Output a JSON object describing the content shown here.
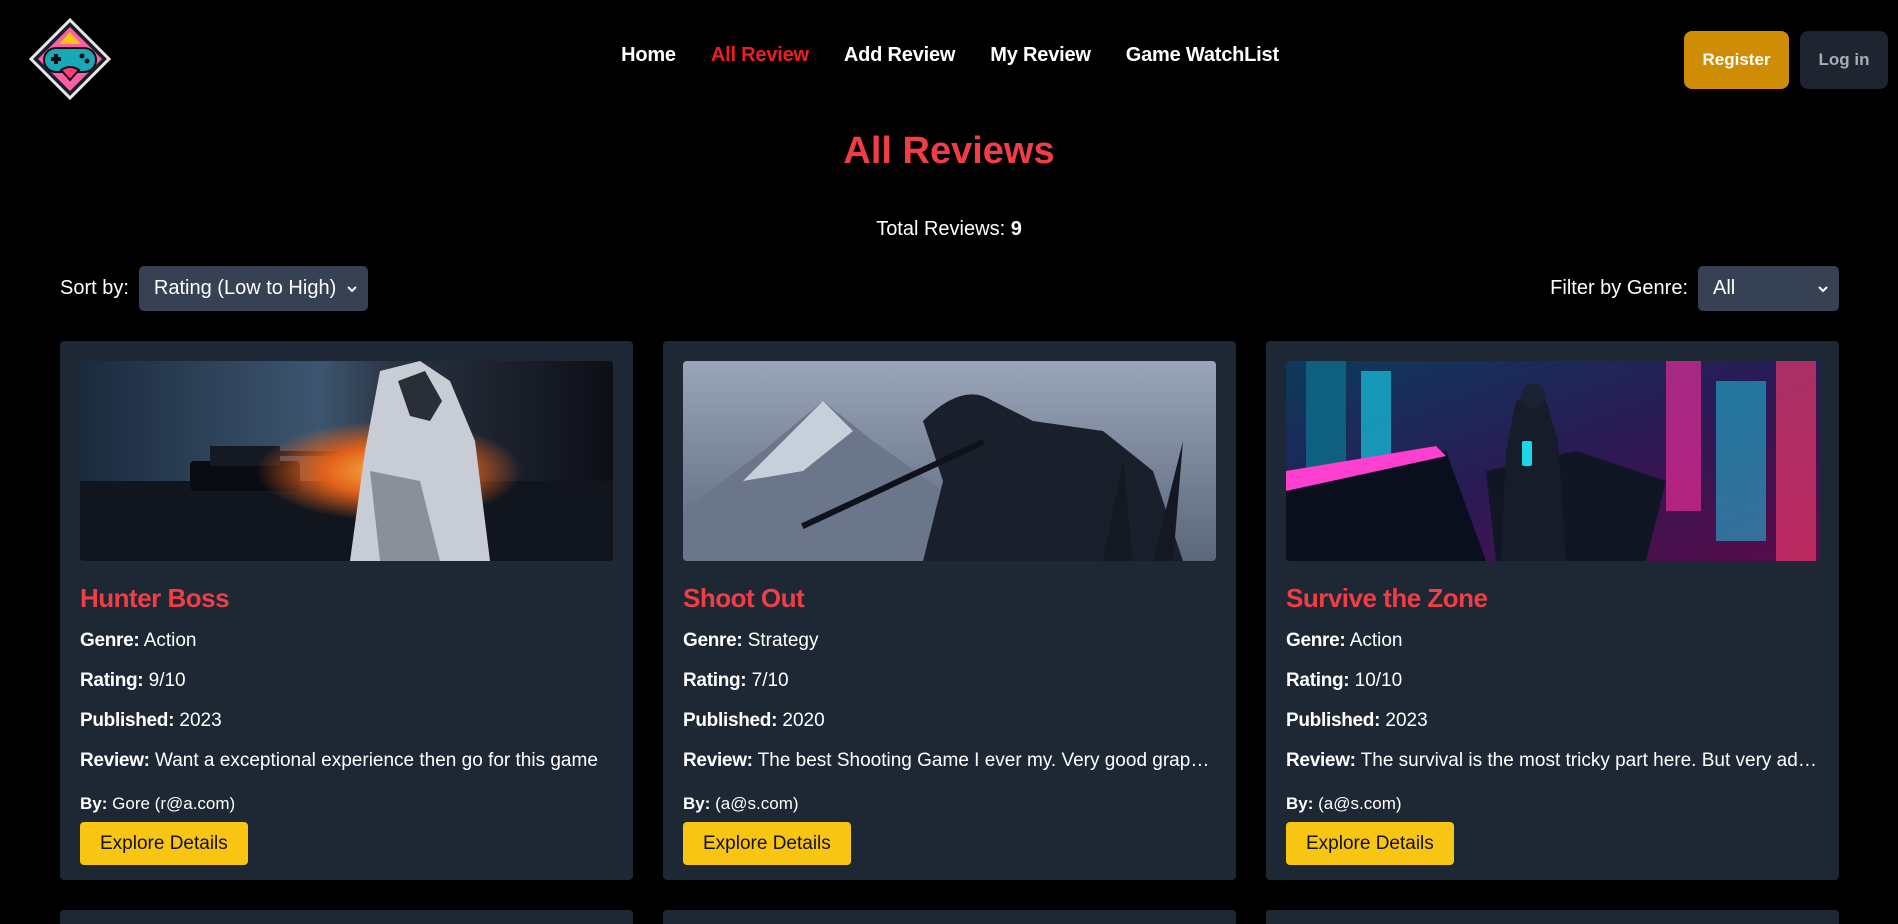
{
  "nav": {
    "links": [
      {
        "label": "Home"
      },
      {
        "label": "All Review",
        "active": true
      },
      {
        "label": "Add Review"
      },
      {
        "label": "My Review"
      },
      {
        "label": "Game WatchList"
      }
    ],
    "register_label": "Register",
    "login_label": "Log in",
    "logo_icon": "gamepad-heart-logo-icon"
  },
  "page": {
    "title": "All Reviews",
    "total_label": "Total Reviews:",
    "total_count": "9"
  },
  "controls": {
    "sort_label": "Sort by:",
    "sort_value": "Rating (Low to High)",
    "filter_label": "Filter by Genre:",
    "filter_value": "All"
  },
  "labels": {
    "genre": "Genre:",
    "rating": "Rating:",
    "published": "Published:",
    "review": "Review:",
    "by": "By:",
    "explore": "Explore Details"
  },
  "cards": [
    {
      "title": "Hunter Boss",
      "genre": "Action",
      "rating": "9/10",
      "published": "2023",
      "review": "Want a exceptional experience then go for this game",
      "by": "Gore (r@a.com)"
    },
    {
      "title": "Shoot Out",
      "genre": "Strategy",
      "rating": "7/10",
      "published": "2020",
      "review": "The best Shooting Game I ever my. Very good graphics",
      "by": "(a@s.com)"
    },
    {
      "title": "Survive the Zone",
      "genre": "Action",
      "rating": "10/10",
      "published": "2023",
      "review": "The survival is the most tricky part here. But very addictive",
      "by": "(a@s.com)"
    }
  ],
  "colors": {
    "accent_red": "#ef3e44",
    "nav_active": "#f01d1d",
    "register_bg": "#cf8d05",
    "explore_bg": "#f9c513",
    "card_bg": "#1e2734"
  }
}
